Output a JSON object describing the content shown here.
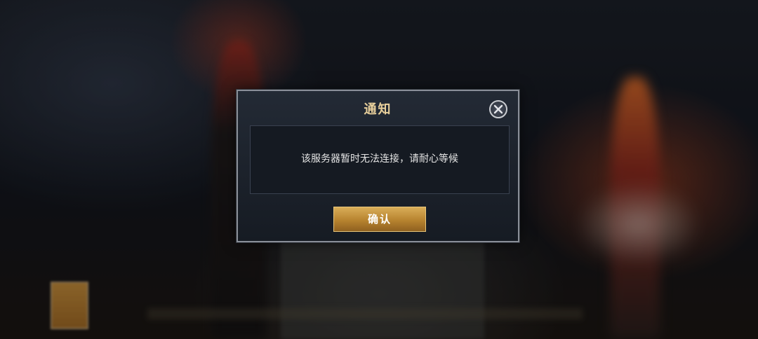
{
  "dialog": {
    "title": "通知",
    "message": "该服务器暂时无法连接，请耐心等候",
    "confirm_label": "确认",
    "close_icon": "close-icon"
  },
  "colors": {
    "title": "#e8cf9b",
    "button_gold": "#c9963f",
    "message_text": "#e6e6e6"
  }
}
